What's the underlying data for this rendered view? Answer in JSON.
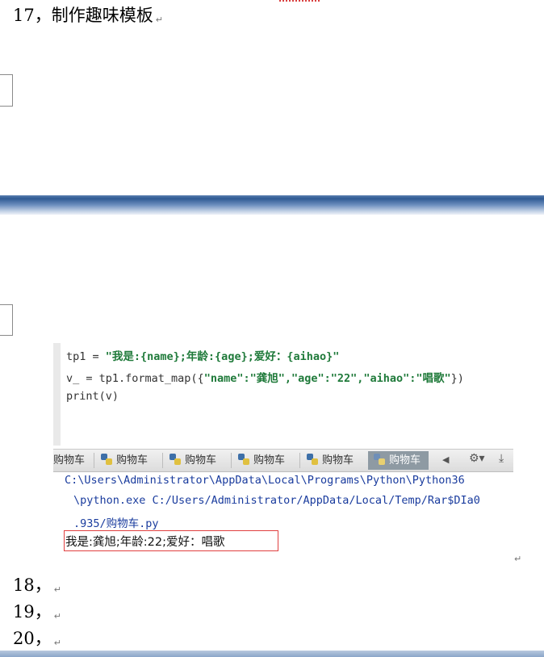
{
  "document": {
    "heading_17": "17，制作趣味模板",
    "item_18": "18，",
    "item_19": "19，",
    "item_20": "20，",
    "paragraph_mark": "↵"
  },
  "code_editor": {
    "lines": [
      {
        "pre": "tp1 = ",
        "str": "\"我是:{name};年龄:{age};爱好：{aihao}\"",
        "post": ""
      },
      {
        "pre": "v_ = tp1.format_map({",
        "str": "\"name\":\"龚旭\",\"age\":\"22\",\"aihao\":\"唱歌\"",
        "post": "})"
      },
      {
        "pre": "print(v)",
        "str": "",
        "post": ""
      }
    ]
  },
  "run_tabs": {
    "first_label": "购物车",
    "tabs": [
      "购物车",
      "购物车",
      "购物车",
      "购物车"
    ],
    "active_tab": "购物车",
    "arrow_left": "◀",
    "gear": "⚙▾",
    "download": "⤓"
  },
  "console": {
    "line1": "C:\\Users\\Administrator\\AppData\\Local\\Programs\\Python\\Python36",
    "line2": "\\python.exe C:/Users/Administrator/AppData/Local/Temp/Rar$DIa0",
    "line3": ".935/购物车.py",
    "result": "我是:龚旭;年龄:22;爱好：唱歌"
  },
  "colors": {
    "string_green": "#1f7a3a",
    "console_blue": "#1a3c9e",
    "highlight_red": "#e04040",
    "page_break_blue": "#2f5a93"
  }
}
